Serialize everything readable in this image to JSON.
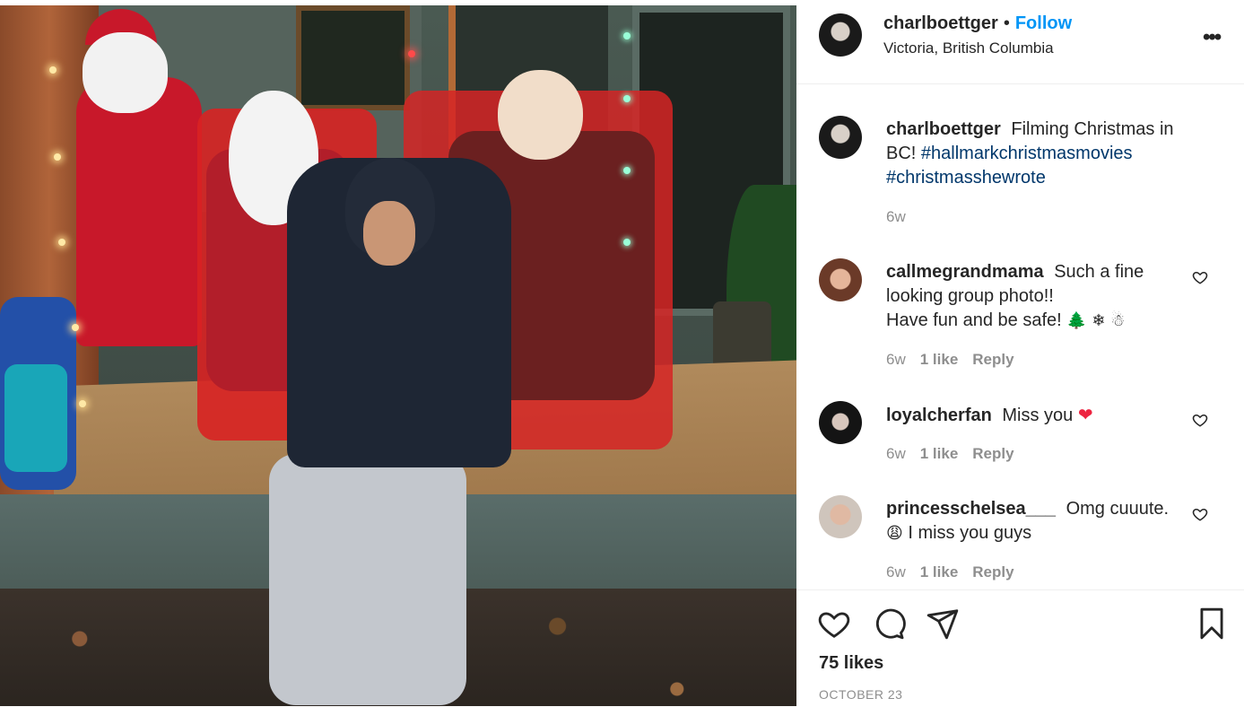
{
  "post": {
    "author": "charlboettger",
    "follow_label": "Follow",
    "separator": "•",
    "location": "Victoria, British Columbia",
    "more_label": "•••"
  },
  "caption": {
    "username": "charlboettger",
    "text": "Filming Christmas in BC!",
    "hashtags": [
      "#hallmarkchristmasmovies",
      "#christmasshewrote"
    ],
    "time": "6w"
  },
  "comments": [
    {
      "username": "callmegrandmama",
      "text_line1": "Such a fine looking group photo!!",
      "text_line2": "Have fun and be safe!",
      "emojis": "🌲 ❄ ☃",
      "time": "6w",
      "likes": "1 like",
      "reply": "Reply"
    },
    {
      "username": "loyalcherfan",
      "text": "Miss you",
      "emoji": "❤",
      "time": "6w",
      "likes": "1 like",
      "reply": "Reply"
    },
    {
      "username": "princesschelsea___",
      "text_line1": "Omg cuuute.",
      "emoji": "😩",
      "text_line2": "I miss you guys",
      "time": "6w",
      "likes": "1 like",
      "reply": "Reply"
    }
  ],
  "footer": {
    "likes": "75 likes",
    "date": "OCTOBER 23"
  },
  "colors": {
    "follow": "#0095f6",
    "hashtag": "#00376b",
    "muted": "#8e8e8e",
    "text": "#262626",
    "heart": "#ed2440"
  },
  "icons": [
    "like-icon",
    "comment-icon",
    "share-icon",
    "save-icon",
    "more-icon",
    "heart-outline-icon"
  ]
}
